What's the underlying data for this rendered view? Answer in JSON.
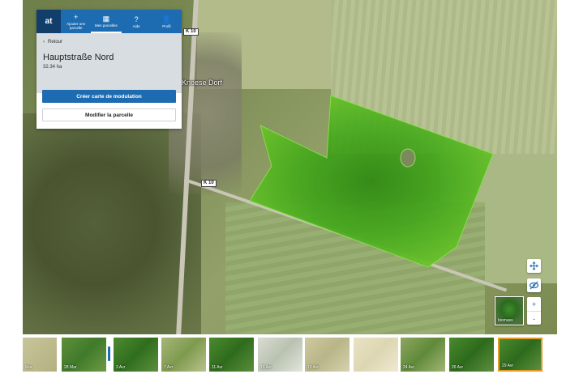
{
  "navbar": {
    "logo": "at",
    "items": [
      {
        "icon": "+",
        "label": "Ajouter une parcelle"
      },
      {
        "icon": "▦",
        "label": "Mes parcelles"
      },
      {
        "icon": "?",
        "label": "Aide"
      },
      {
        "icon": "👤",
        "label": "Profil"
      }
    ]
  },
  "panel": {
    "back_label": "Retour",
    "parcel_name": "Hauptstraße Nord",
    "parcel_area": "32.34 ha",
    "primary_button": "Créer carte de modulation",
    "secondary_button": "Modifier la parcelle"
  },
  "map": {
    "road_labels": [
      "K 10",
      "K 10"
    ],
    "place_name": "Kneese Dorf",
    "layer_label": "biomass",
    "zoom_in": "+",
    "zoom_out": "-"
  },
  "timeline": {
    "dates": [
      "Mar",
      "28 Mar",
      "3 Avr",
      "7 Avr",
      "11 Avr",
      "18 Avr",
      "19 Avr",
      "",
      "24 Avr",
      "26 Avr",
      "29 Avr"
    ],
    "selected_index": 10
  },
  "colors": {
    "primary": "#1d6bb0",
    "selected": "#e39a27"
  }
}
